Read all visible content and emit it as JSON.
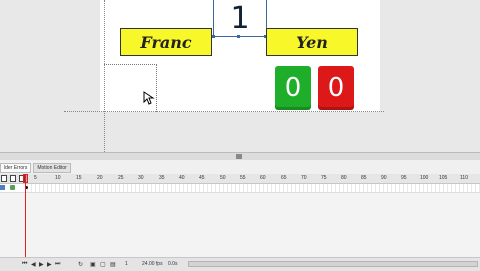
{
  "stage": {
    "label_left": "Franc",
    "label_right": "Yen",
    "counter_value": "1",
    "score_green": "0",
    "score_red": "0",
    "colors": {
      "label_bg": "#f7f72a",
      "score_green": "#1fae2a",
      "score_red": "#dd1818"
    }
  },
  "timeline": {
    "tabs": [
      "lder Errors",
      "Motion Editor"
    ],
    "ruler_ticks": [
      "5",
      "10",
      "15",
      "20",
      "25",
      "30",
      "35",
      "40",
      "45",
      "50",
      "55",
      "60",
      "65",
      "70",
      "75",
      "80",
      "85",
      "90",
      "95",
      "100",
      "105",
      "110"
    ],
    "status": {
      "current_frame": "1",
      "fps": "24.00 fps",
      "elapsed": "0.0s"
    }
  },
  "icons": [
    "layer-icon",
    "eye-icon",
    "lock-icon",
    "outline-icon",
    "play-icon",
    "rewind-icon",
    "forward-icon",
    "cursor-icon"
  ]
}
